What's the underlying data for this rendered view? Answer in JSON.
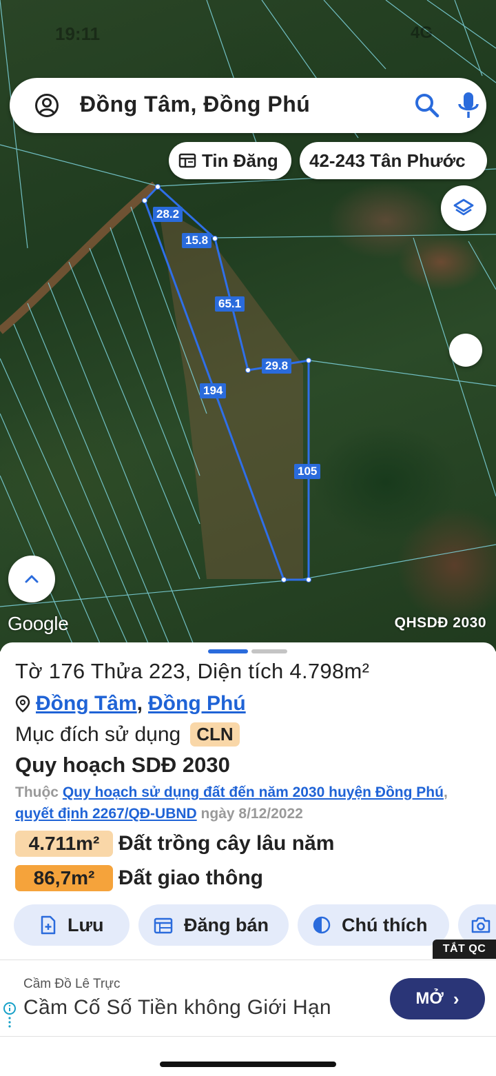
{
  "status": {
    "time": "19:11",
    "network": "4G"
  },
  "search": {
    "query": "Đồng Tâm, Đồng Phú"
  },
  "chips": {
    "news": "Tin Đăng",
    "parcel": "42-243 Tân Phước"
  },
  "map": {
    "logo": "Google",
    "layer_label": "QHSDĐ 2030",
    "dimensions": {
      "d1": "28.2",
      "d2": "15.8",
      "d3": "65.1",
      "d4": "29.8",
      "d5": "194",
      "d6": "105"
    }
  },
  "parcel": {
    "title": "Tờ 176 Thửa 223, Diện tích 4.798m²",
    "commune": "Đồng Tâm",
    "separator": ",",
    "district": "Đồng Phú",
    "purpose_label": "Mục đích sử dụng",
    "purpose_code": "CLN",
    "plan_title": "Quy hoạch SDĐ 2030",
    "plan_prefix": "Thuộc",
    "plan_link": "Quy hoạch sử dụng đất đến năm 2030 huyện Đồng Phú",
    "plan_comma": ",",
    "decision_link": "quyết định 2267/QĐ-UBND",
    "decision_date": "ngày 8/12/2022",
    "areas": [
      {
        "value": "4.711m²",
        "label": "Đất trồng cây lâu năm"
      },
      {
        "value": "86,7m²",
        "label": "Đất giao thông"
      }
    ]
  },
  "actions": {
    "save": "Lưu",
    "sell": "Đăng bán",
    "legend": "Chú thích"
  },
  "ad": {
    "hide_label": "TẮT QC",
    "sponsor": "Cầm Đồ Lê Trực",
    "headline": "Cầm Cố Số Tiền không Giới Hạn",
    "cta": "MỞ"
  },
  "colors": {
    "accent": "#2a6bdc",
    "badge_light": "#f9d7a8",
    "badge_orange": "#f5a33b",
    "ad_cta": "#2a3577"
  }
}
